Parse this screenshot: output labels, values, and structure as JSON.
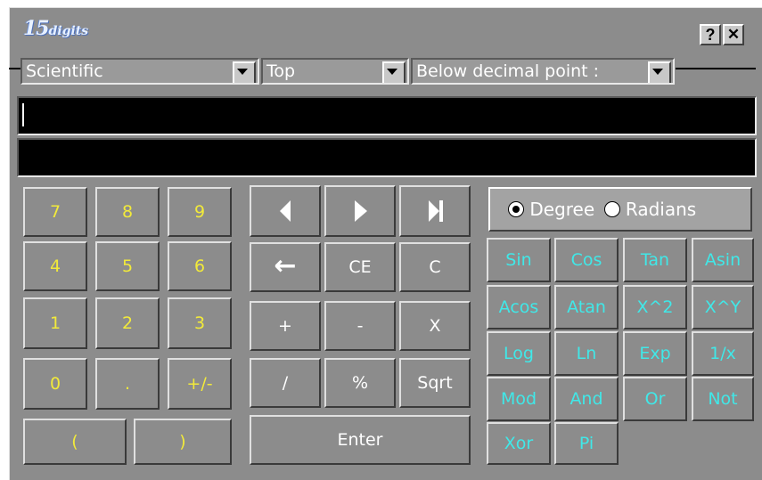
{
  "app": {
    "logo_number": "15",
    "logo_word": "digits"
  },
  "titlebar": {
    "help_label": "?",
    "close_label": "✕"
  },
  "combos": {
    "mode": "Scientific",
    "position": "Top",
    "decimal": "Below decimal point :"
  },
  "display": {
    "input": "",
    "result": ""
  },
  "numpad": {
    "seven": "7",
    "eight": "8",
    "nine": "9",
    "four": "4",
    "five": "5",
    "six": "6",
    "one": "1",
    "two": "2",
    "three": "3",
    "zero": "0",
    "dot": ".",
    "sign": "+/-",
    "open_paren": "(",
    "close_paren": ")"
  },
  "ops": {
    "backspace": "←",
    "ce": "CE",
    "c": "C",
    "plus": "+",
    "minus": "-",
    "times": "X",
    "divide": "/",
    "percent": "%",
    "sqrt": "Sqrt",
    "enter": "Enter"
  },
  "angle": {
    "degree": "Degree",
    "radians": "Radians",
    "selected": "Degree"
  },
  "sci": {
    "sin": "Sin",
    "cos": "Cos",
    "tan": "Tan",
    "asin": "Asin",
    "acos": "Acos",
    "atan": "Atan",
    "sq": "X^2",
    "pow": "X^Y",
    "log": "Log",
    "ln": "Ln",
    "exp": "Exp",
    "inv": "1/x",
    "mod": "Mod",
    "and": "And",
    "or": "Or",
    "not": "Not",
    "xor": "Xor",
    "pi": "Pi"
  },
  "colors": {
    "window": "#8c8c8c",
    "digit_text": "#f2ea3a",
    "sci_text": "#40e8e8",
    "op_text": "#ffffff"
  }
}
